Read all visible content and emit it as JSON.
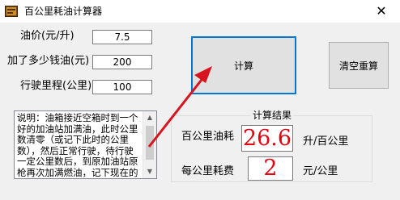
{
  "window": {
    "title": "百公里耗油计算器",
    "close_glyph": "✕"
  },
  "inputs": {
    "price": {
      "label": "油价(元/升)",
      "value": "7.5"
    },
    "amount": {
      "label": "加了多少钱油(元)",
      "value": "200"
    },
    "distance": {
      "label": "行驶里程(公里)",
      "value": "100"
    }
  },
  "buttons": {
    "calculate": "计算",
    "clear": "清空重算"
  },
  "description": "说明：油箱接近空箱时到一个好的加油站加满油，此时公里数清零（或记下此时的公里数），然后正常行驶，待行驶一定公里数后，到原加油站原枪再次加满燃油，记下现在的公里数。",
  "results": {
    "group_title": "计算结果",
    "per_100km": {
      "label": "百公里油耗",
      "value": "26.6",
      "unit": "升/百公里"
    },
    "per_km": {
      "label": "每公里耗费",
      "value": "2",
      "unit": "元/公里"
    }
  },
  "colors": {
    "result_value": "#e60012",
    "arrow": "#d7141e",
    "default_button_border": "#0078d7"
  },
  "icons": {
    "app": "fuel-app-icon",
    "close": "close-icon"
  }
}
